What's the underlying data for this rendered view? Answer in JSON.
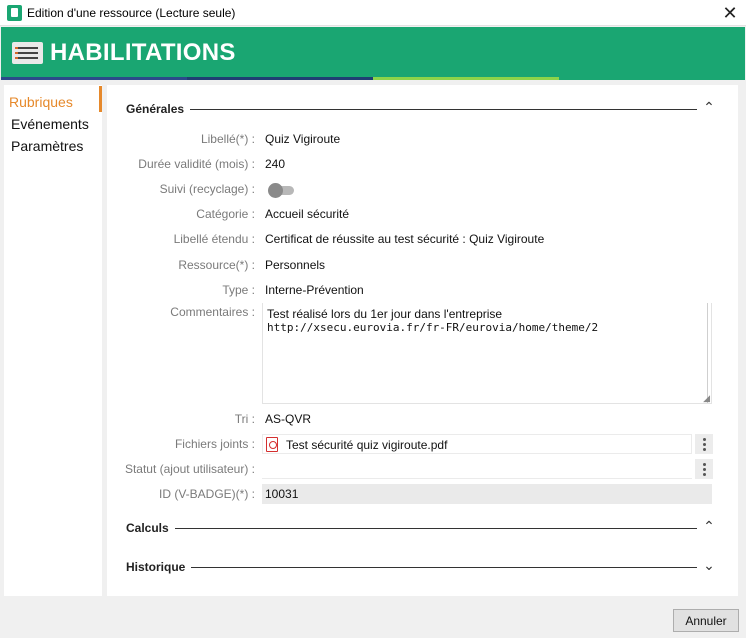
{
  "window": {
    "title": "Edition d'une ressource (Lecture seule)",
    "close_glyph": "✕"
  },
  "banner": {
    "title": "HABILITATIONS",
    "color": "#1aa672"
  },
  "stripe_colors": [
    "#2b4a8a",
    "#1f3f73",
    "#8cd44a",
    "#1aa672"
  ],
  "sidebar": {
    "items": [
      {
        "label": "Rubriques",
        "active": true
      },
      {
        "label": "Evénements",
        "active": false
      },
      {
        "label": "Paramètres",
        "active": false
      }
    ],
    "accent": "#e6892b"
  },
  "sections": {
    "generales": {
      "title": "Générales",
      "chevron": "⌃"
    },
    "calculs": {
      "title": "Calculs",
      "chevron": "⌃"
    },
    "historique": {
      "title": "Historique",
      "chevron": "⌄"
    }
  },
  "fields": {
    "libelle": {
      "label": "Libellé(*) :",
      "value": "Quiz Vigiroute"
    },
    "duree": {
      "label": "Durée validité (mois) :",
      "value": "240"
    },
    "suivi": {
      "label": "Suivi (recyclage) :",
      "checked": false
    },
    "categorie": {
      "label": "Catégorie :",
      "value": "Accueil sécurité"
    },
    "libelle_etendu": {
      "label": "Libellé étendu :",
      "value": "Certificat de réussite au test sécurité : Quiz Vigiroute"
    },
    "ressource": {
      "label": "Ressource(*) :",
      "value": "Personnels"
    },
    "type": {
      "label": "Type :",
      "value": "Interne-Prévention"
    },
    "commentaires": {
      "label": "Commentaires :",
      "lines": [
        "Test réalisé lors du 1er jour dans l'entreprise",
        "http://xsecu.eurovia.fr/fr-FR/eurovia/home/theme/2"
      ]
    },
    "tri": {
      "label": "Tri :",
      "value": "AS-QVR"
    },
    "fichiers": {
      "label": "Fichiers joints :",
      "value": "Test sécurité quiz vigiroute.pdf",
      "icon": "pdf-icon"
    },
    "statut": {
      "label": "Statut (ajout utilisateur) :",
      "value": ""
    },
    "id_badge": {
      "label": "ID (V-BADGE)(*) :",
      "value": "10031"
    }
  },
  "footer": {
    "cancel_label": "Annuler"
  }
}
